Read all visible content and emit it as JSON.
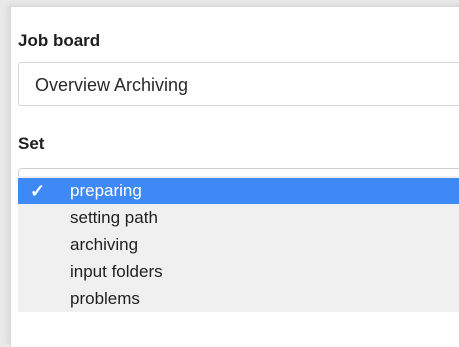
{
  "form": {
    "job_board_label": "Job board",
    "job_board_value": "Overview Archiving",
    "set_label": "Set"
  },
  "dropdown": {
    "selected_index": 0,
    "check_glyph": "✓",
    "options": [
      {
        "label": "preparing",
        "selected": true
      },
      {
        "label": "setting path",
        "selected": false
      },
      {
        "label": "archiving",
        "selected": false
      },
      {
        "label": "input folders",
        "selected": false
      },
      {
        "label": "problems",
        "selected": false
      }
    ]
  },
  "colors": {
    "selection": "#3d8af7",
    "menu_background": "#f0f0f0"
  }
}
